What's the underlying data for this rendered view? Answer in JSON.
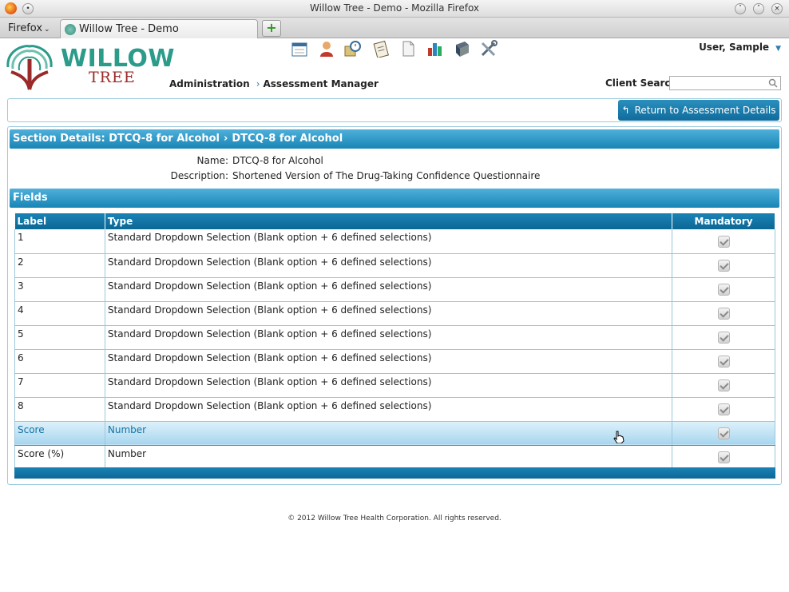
{
  "window": {
    "title": "Willow Tree - Demo - Mozilla Firefox"
  },
  "browser": {
    "menu_label": "Firefox",
    "tab_title": "Willow Tree - Demo",
    "new_tab_label": "+"
  },
  "brand": {
    "line1": "WILLOW",
    "line2": "TREE"
  },
  "nav": {
    "crumb1": "Administration",
    "crumb2": "Assessment Manager",
    "separator": "›"
  },
  "user": {
    "name": "User, Sample"
  },
  "client_search": {
    "label": "Client Search",
    "placeholder": ""
  },
  "toolbar_icons": [
    "calendar-icon",
    "client-icon",
    "search-clock-icon",
    "clipboard-icon",
    "document-icon",
    "chart-icon",
    "book-icon",
    "tools-icon"
  ],
  "actions": {
    "return_label": "Return to Assessment Details"
  },
  "section": {
    "title_part1": "Section Details: DTCQ-8 for Alcohol",
    "title_part2": "DTCQ-8 for Alcohol",
    "separator": "›",
    "name_label": "Name:",
    "name_value": "DTCQ-8 for Alcohol",
    "description_label": "Description:",
    "description_value": "Shortened Version of The Drug-Taking Confidence Questionnaire"
  },
  "fields": {
    "title": "Fields",
    "columns": [
      "Label",
      "Type",
      "Mandatory"
    ],
    "rows": [
      {
        "label": "1",
        "type": "Standard Dropdown Selection (Blank option + 6 defined selections)",
        "mandatory": true
      },
      {
        "label": "2",
        "type": "Standard Dropdown Selection (Blank option + 6 defined selections)",
        "mandatory": true
      },
      {
        "label": "3",
        "type": "Standard Dropdown Selection (Blank option + 6 defined selections)",
        "mandatory": true
      },
      {
        "label": "4",
        "type": "Standard Dropdown Selection (Blank option + 6 defined selections)",
        "mandatory": true
      },
      {
        "label": "5",
        "type": "Standard Dropdown Selection (Blank option + 6 defined selections)",
        "mandatory": true
      },
      {
        "label": "6",
        "type": "Standard Dropdown Selection (Blank option + 6 defined selections)",
        "mandatory": true
      },
      {
        "label": "7",
        "type": "Standard Dropdown Selection (Blank option + 6 defined selections)",
        "mandatory": true
      },
      {
        "label": "8",
        "type": "Standard Dropdown Selection (Blank option + 6 defined selections)",
        "mandatory": true
      },
      {
        "label": "Score",
        "type": "Number",
        "mandatory": true,
        "highlighted": true
      },
      {
        "label": "Score (%)",
        "type": "Number",
        "mandatory": true
      }
    ]
  },
  "footer": {
    "copyright": "© 2012 Willow Tree Health Corporation. All rights reserved."
  },
  "colors": {
    "accent": "#1885b5",
    "brand_green": "#2b9b8a",
    "brand_red": "#9b2a2a"
  }
}
